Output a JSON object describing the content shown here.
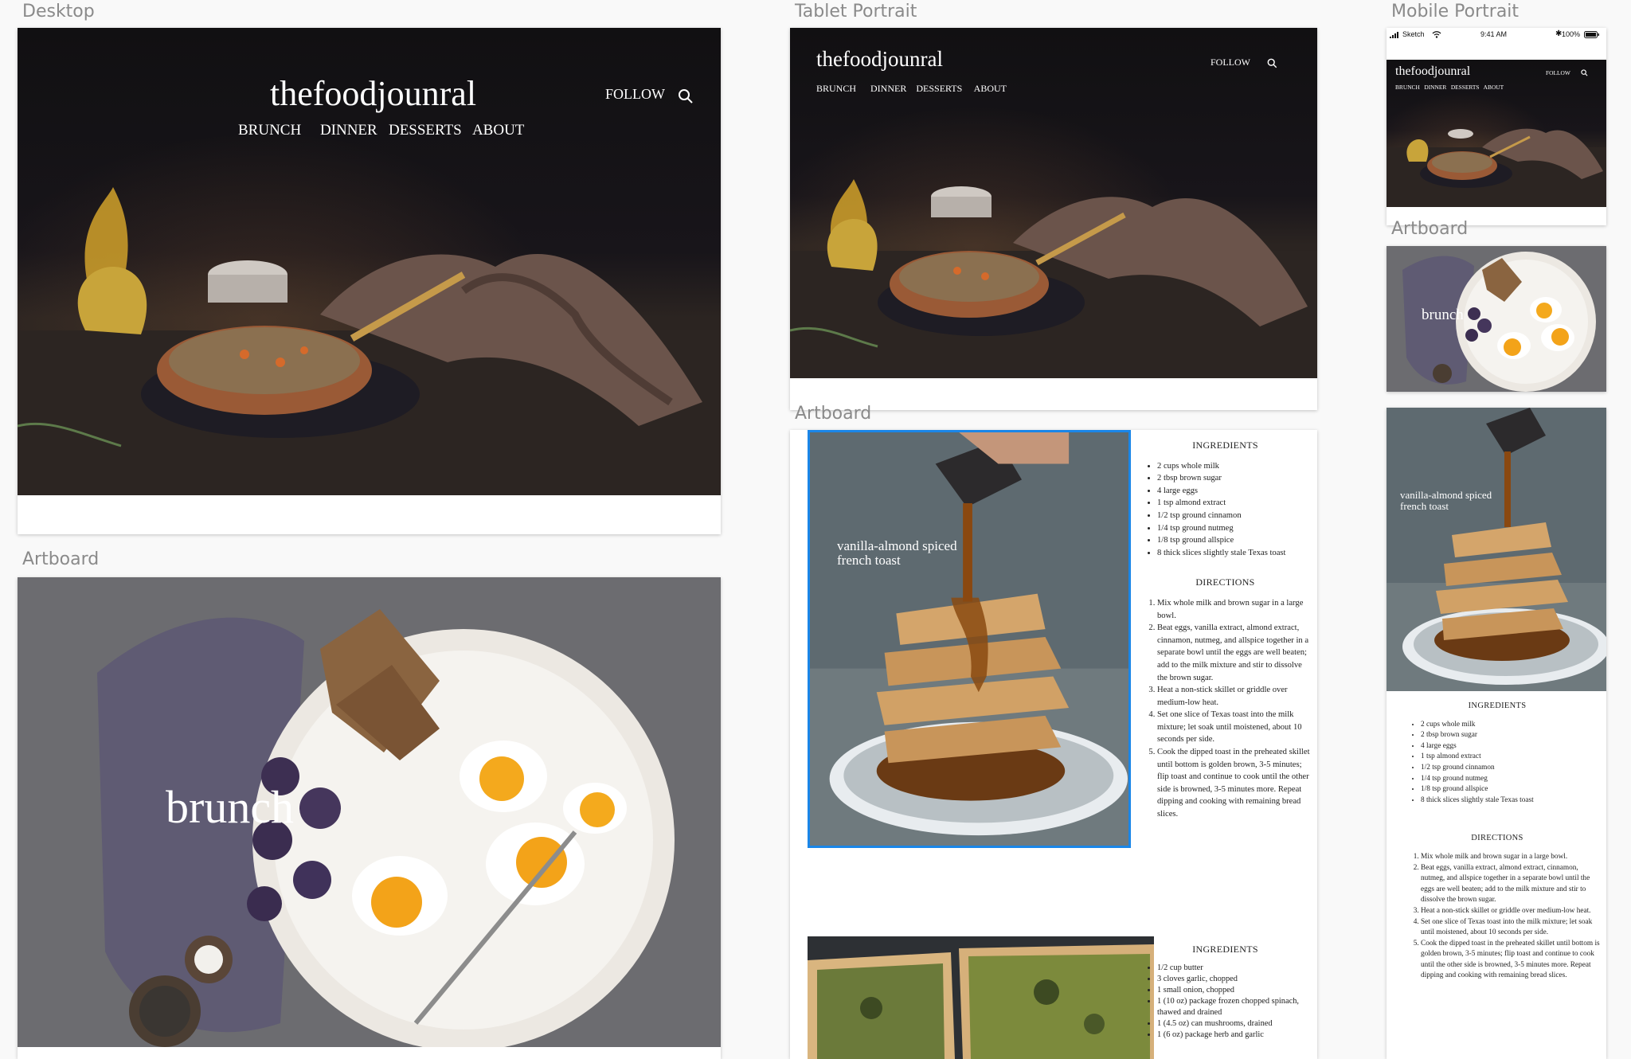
{
  "artboard_labels": {
    "desktop": "Desktop",
    "tablet": "Tablet Portrait",
    "mobile": "Mobile Portrait",
    "artboard": "Artboard"
  },
  "site": {
    "brand": "thefoodjounral",
    "nav": [
      "BRUNCH",
      "DINNER",
      "DESSERTS",
      "ABOUT"
    ],
    "follow": "FOLLOW"
  },
  "brunch": {
    "title": "brunch"
  },
  "recipe_toast": {
    "title_line1": "vanilla-almond spiced",
    "title_line2": "french toast",
    "ingredients_heading": "INGREDIENTS",
    "ingredients": [
      "2 cups whole milk",
      "2 tbsp brown sugar",
      "4 large eggs",
      "1 tsp almond extract",
      "1/2 tsp ground cinnamon",
      "1/4 tsp ground nutmeg",
      "1/8 tsp ground allspice",
      "8 thick slices slightly stale Texas toast"
    ],
    "directions_heading": "DIRECTIONS",
    "directions": [
      "Mix whole milk and brown sugar in a large bowl.",
      "Beat eggs, vanilla extract, almond extract, cinnamon, nutmeg, and allspice together in a separate bowl until the eggs are well beaten; add to the milk mixture and stir to dissolve the brown sugar.",
      "Heat a non-stick skillet or griddle over medium-low heat.",
      "Set one slice of Texas toast into the milk mixture; let soak until moistened, about 10 seconds per side.",
      "Cook the dipped toast in the preheated skillet until bottom is golden brown, 3-5 minutes; flip toast and continue to cook until the other side is browned, 3-5 minutes more. Repeat dipping and cooking with remaining bread slices."
    ]
  },
  "recipe_quiche": {
    "ingredients_heading": "INGREDIENTS",
    "ingredients": [
      "1/2 cup butter",
      "3 cloves garlic, chopped",
      "1 small onion, chopped",
      "1 (10 oz) package frozen chopped spinach, thawed and drained",
      "1 (4.5 oz) can mushrooms, drained",
      "1 (6 oz) package herb and garlic"
    ]
  },
  "status_bar": {
    "carrier": "Sketch",
    "time": "9:41 AM",
    "battery": "100%"
  },
  "colors": {
    "selection": "#1a86e8",
    "canvas": "#f9f9f9"
  },
  "icons": [
    "search-icon",
    "wifi-icon",
    "bluetooth-icon",
    "battery-icon",
    "signal-icon"
  ]
}
